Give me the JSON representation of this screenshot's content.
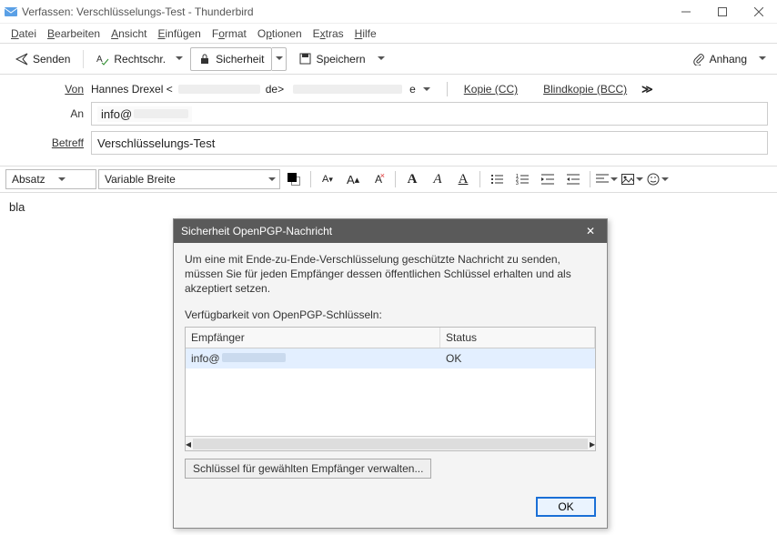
{
  "window": {
    "title": "Verfassen: Verschlüsselungs-Test - Thunderbird"
  },
  "menu": {
    "file": "Datei",
    "edit": "Bearbeiten",
    "view": "Ansicht",
    "insert": "Einfügen",
    "format": "Format",
    "options": "Optionen",
    "extras": "Extras",
    "help": "Hilfe"
  },
  "toolbar": {
    "send": "Senden",
    "spelling": "Rechtschr.",
    "security": "Sicherheit",
    "save": "Speichern",
    "attach": "Anhang"
  },
  "headers": {
    "from_label": "Von",
    "from_name": "Hannes Drexel <",
    "from_tail": "de>",
    "cc": "Kopie (CC)",
    "bcc": "Blindkopie (BCC)",
    "to_label": "An",
    "to_value": "info@",
    "subject_label": "Betreff",
    "subject_value": "Verschlüsselungs-Test"
  },
  "format": {
    "para": "Absatz",
    "font": "Variable Breite"
  },
  "body": {
    "text": "bla"
  },
  "modal": {
    "title": "Sicherheit OpenPGP-Nachricht",
    "text": "Um eine mit Ende-zu-Ende-Verschlüsselung geschützte Nachricht zu senden, müssen Sie für jeden Empfänger dessen öffentlichen Schlüssel erhalten und als akzeptiert setzen.",
    "avail": "Verfügbarkeit von OpenPGP-Schlüsseln:",
    "col_recipient": "Empfänger",
    "col_status": "Status",
    "row_recipient": "info@",
    "row_status": "OK",
    "manage": "Schlüssel für gewählten Empfänger verwalten...",
    "ok": "OK"
  }
}
